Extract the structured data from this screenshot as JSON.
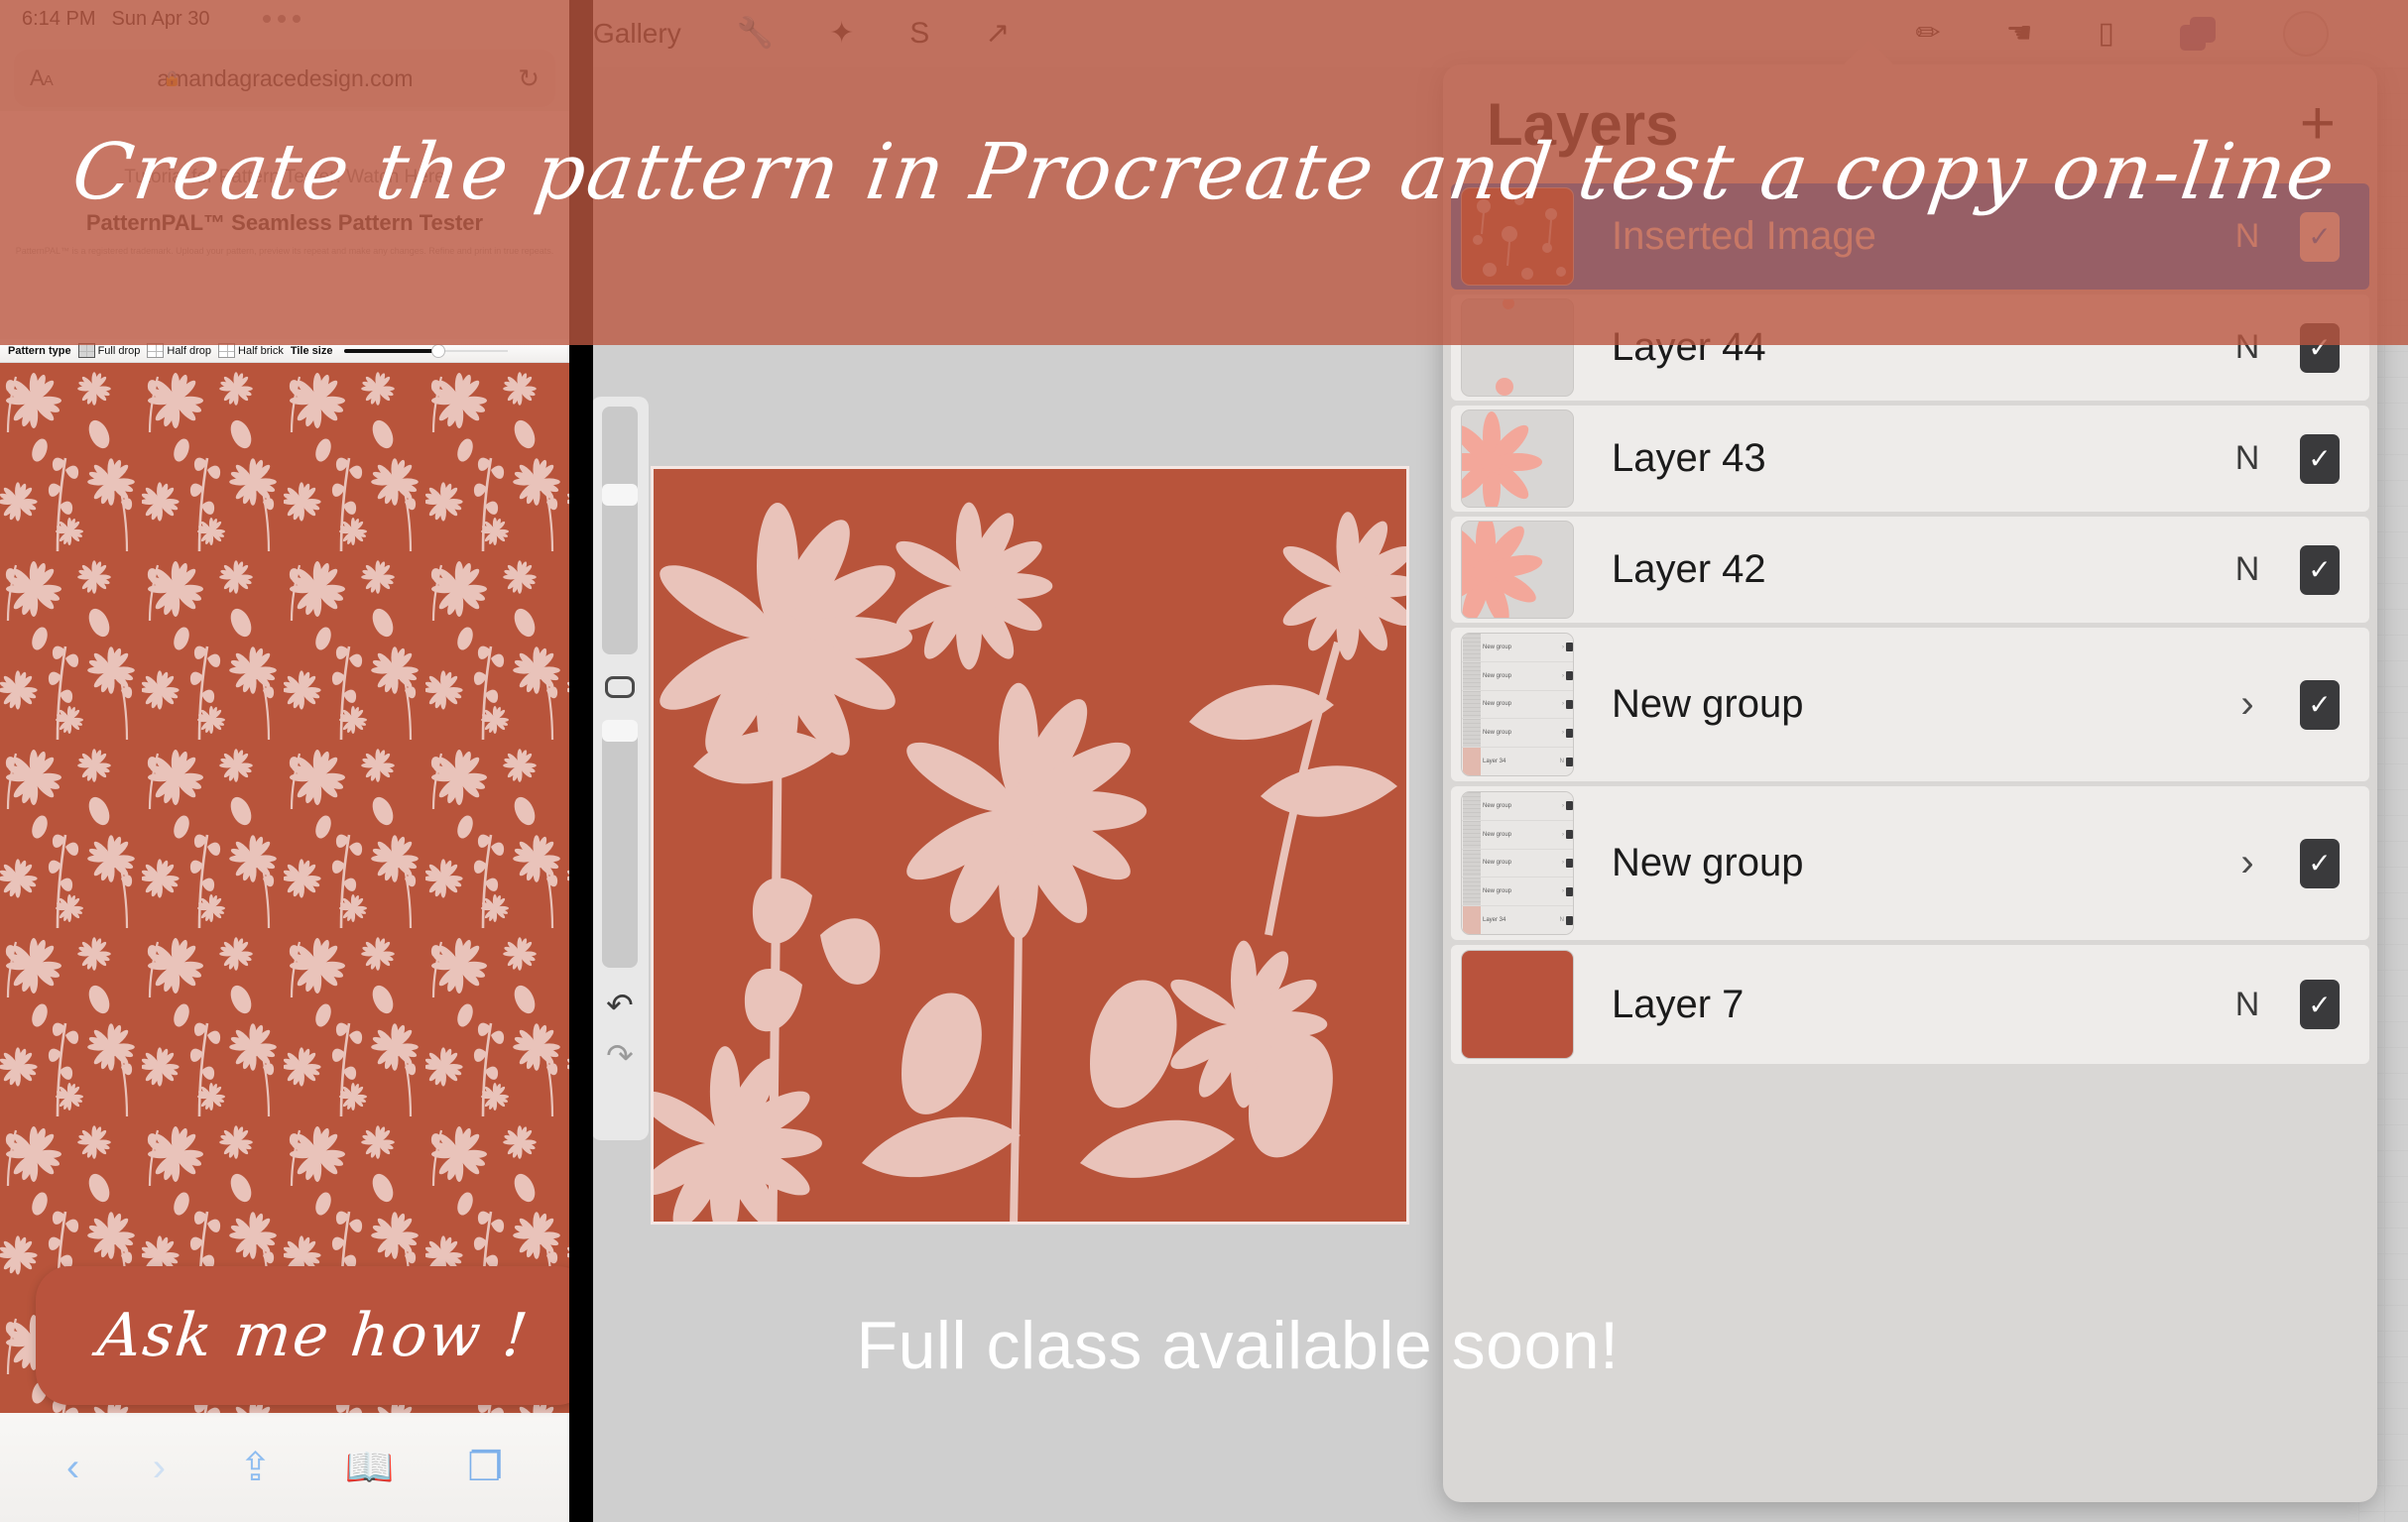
{
  "overlay": {
    "headline": "Create the pattern in Procreate and test a copy on-line",
    "cta_pill": "Ask me how !",
    "band_color": "#ba5640"
  },
  "status_bar": {
    "time": "6:14 PM",
    "date": "Sun Apr 30",
    "multitask_dots_icon": "multitask-dots-icon"
  },
  "safari": {
    "aa_button": "AA",
    "url": "amandagracedesign.com",
    "lock_icon": "lock-icon",
    "reload_icon": "reload-icon",
    "bottom_bar": {
      "back_icon": "chevron-left-icon",
      "forward_icon": "chevron-right-icon",
      "share_icon": "share-icon",
      "bookmarks_icon": "book-icon",
      "tabs_icon": "tabs-icon"
    }
  },
  "patternpal": {
    "tutorial_link": "Tutorial for Pattern Tester: Watch Here",
    "title": "PatternPAL™ Seamless Pattern Tester",
    "fine_print": "PatternPAL™ is a registered trademark. Upload your pattern, preview its repeat and make any changes. Refine and print in true repeats.",
    "toolbar": {
      "pattern_type_label": "Pattern type",
      "options": [
        {
          "label": "Full drop",
          "selected": true
        },
        {
          "label": "Half drop",
          "selected": false
        },
        {
          "label": "Half brick",
          "selected": false
        }
      ],
      "tile_size_label": "Tile size",
      "tile_size_percent": 53
    }
  },
  "procreate": {
    "gallery_label": "Gallery",
    "left_tools": [
      {
        "name": "wrench-icon",
        "glyph": "🔧"
      },
      {
        "name": "magic-wand-icon",
        "glyph": "✨"
      },
      {
        "name": "selection-icon",
        "glyph": "S"
      },
      {
        "name": "transform-icon",
        "glyph": "↗"
      }
    ],
    "right_tools": [
      {
        "name": "brush-icon",
        "glyph": "✒"
      },
      {
        "name": "smudge-icon",
        "glyph": "☝"
      },
      {
        "name": "eraser-icon",
        "glyph": "▱"
      },
      {
        "name": "layers-icon",
        "glyph": ""
      },
      {
        "name": "color-swatch",
        "glyph": ""
      }
    ],
    "sidebar": {
      "brush_size_icon": "brush-size-slider",
      "modify_icon": "modify-square-icon",
      "opacity_icon": "opacity-slider",
      "undo_icon": "undo-arrow-icon",
      "redo_icon": "redo-arrow-icon"
    },
    "caption": "Full class available soon!"
  },
  "layers_panel": {
    "title": "Layers",
    "add_label": "+",
    "rows": [
      {
        "name": "Inserted Image",
        "blend": "N",
        "checked": true,
        "selected": true,
        "thumb": "pattern",
        "kind": "layer"
      },
      {
        "name": "Layer 44",
        "blend": "N",
        "checked": true,
        "selected": false,
        "thumb": "sparse",
        "kind": "layer"
      },
      {
        "name": "Layer 43",
        "blend": "N",
        "checked": true,
        "selected": false,
        "thumb": "flower-l",
        "kind": "layer"
      },
      {
        "name": "Layer 42",
        "blend": "N",
        "checked": true,
        "selected": false,
        "thumb": "flower-c",
        "kind": "layer"
      },
      {
        "name": "New group",
        "blend": "",
        "checked": true,
        "selected": false,
        "thumb": "group",
        "kind": "group"
      },
      {
        "name": "New group",
        "blend": "",
        "checked": true,
        "selected": false,
        "thumb": "group",
        "kind": "group"
      },
      {
        "name": "Layer 7",
        "blend": "N",
        "checked": true,
        "selected": false,
        "thumb": "solid",
        "kind": "layer"
      }
    ],
    "group_children_label": "New group",
    "group_last_child_label": "Layer 34",
    "chevron_glyph": "›",
    "check_glyph": "✓"
  },
  "colors": {
    "terracotta": "#b9533d",
    "pattern_bg": "#b8543b",
    "pattern_fg": "#e9c3ba",
    "selection_blue": "#0a84ff",
    "panel_bg": "#d9d7d5",
    "row_bg": "#eeecea"
  }
}
